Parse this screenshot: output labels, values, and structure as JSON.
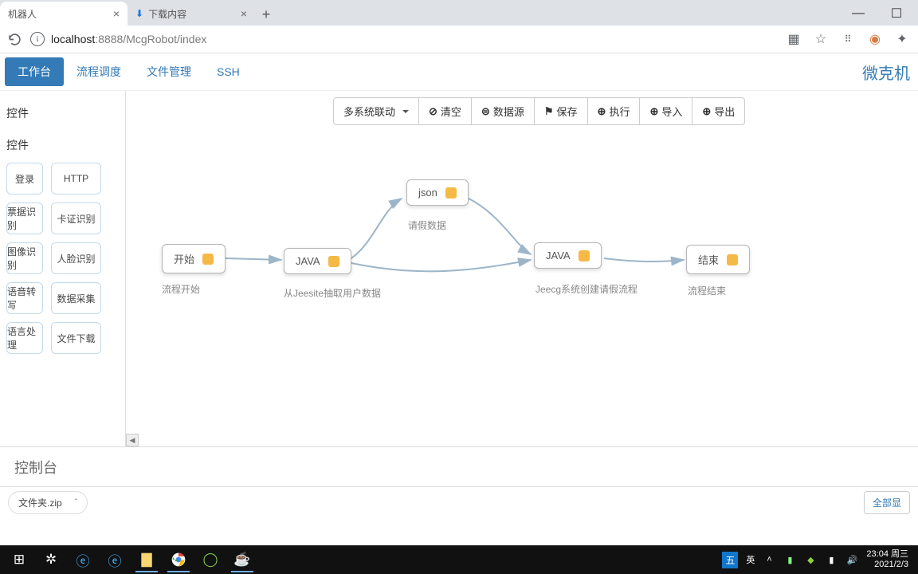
{
  "browser": {
    "tabs": [
      {
        "title": "机器人"
      },
      {
        "title": "下载内容"
      }
    ],
    "url_host": "localhost",
    "url_port_path": ":8888/McgRobot/index"
  },
  "nav": {
    "items": [
      "工作台",
      "流程调度",
      "文件管理",
      "SSH"
    ],
    "brand": "微克机"
  },
  "sidebar": {
    "h1": "控件",
    "h2": "控件",
    "palette": [
      "登录",
      "HTTP",
      "票据识别",
      "卡证识别",
      "图像识别",
      "人脸识别",
      "语音转写",
      "数据采集",
      "语言处理",
      "文件下载"
    ]
  },
  "toolbar": {
    "multi": "多系统联动",
    "clear": "清空",
    "datasource": "数据源",
    "save": "保存",
    "execute": "执行",
    "import": "导入",
    "export": "导出"
  },
  "nodes": {
    "start": {
      "text": "开始",
      "label": "流程开始"
    },
    "java1": {
      "text": "JAVA",
      "label": "从Jeesite抽取用户数据"
    },
    "json": {
      "text": "json",
      "label": "请假数据"
    },
    "java2": {
      "text": "JAVA",
      "label": "Jeecg系统创建请假流程"
    },
    "end": {
      "text": "结束",
      "label": "流程结束"
    }
  },
  "console": {
    "title": "控制台"
  },
  "downloads": {
    "item": "文件夹.zip",
    "show_all": "全部显"
  },
  "taskbar": {
    "ime1": "五",
    "ime2": "英",
    "time": "23:04 周三",
    "date": "2021/2/3"
  }
}
